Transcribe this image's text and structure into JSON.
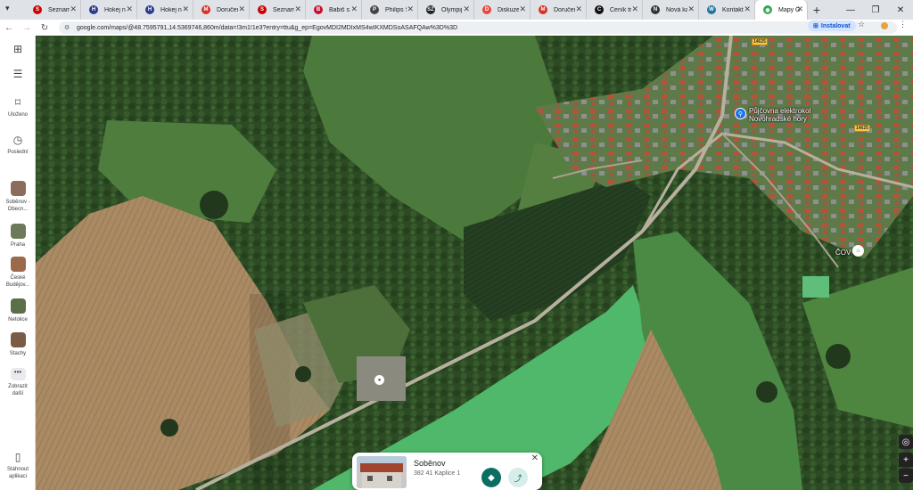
{
  "browser": {
    "tabs": [
      {
        "label": "Seznam",
        "icon": "seznam-icon",
        "color": "#cc0000",
        "glyph": "S"
      },
      {
        "label": "Hokej n",
        "icon": "hockey-icon",
        "color": "#2a3c8f",
        "glyph": "H"
      },
      {
        "label": "Hokej n",
        "icon": "hockey-icon",
        "color": "#2a3c8f",
        "glyph": "H"
      },
      {
        "label": "Doručen",
        "icon": "gmail-icon",
        "color": "#d93025",
        "glyph": "M"
      },
      {
        "label": "Seznam",
        "icon": "seznam-icon",
        "color": "#cc0000",
        "glyph": "S"
      },
      {
        "label": "Babiš s",
        "icon": "news-icon",
        "color": "#c8102e",
        "glyph": "B"
      },
      {
        "label": "Philips S",
        "icon": "philips-icon",
        "color": "#444444",
        "glyph": "P"
      },
      {
        "label": "Olympij",
        "icon": "sz-icon",
        "color": "#222222",
        "glyph": "SZ"
      },
      {
        "label": "Diskuze",
        "icon": "discussion-icon",
        "color": "#e8453c",
        "glyph": "D"
      },
      {
        "label": "Doručen",
        "icon": "gmail-icon",
        "color": "#d93025",
        "glyph": "M"
      },
      {
        "label": "Ceník tr",
        "icon": "price-icon",
        "color": "#111111",
        "glyph": "C"
      },
      {
        "label": "Nová ka",
        "icon": "github-icon",
        "color": "#333333",
        "glyph": "N"
      },
      {
        "label": "Kontakt",
        "icon": "wordpress-icon",
        "color": "#21759b",
        "glyph": "W"
      },
      {
        "label": "Mapy Go",
        "icon": "maps-icon",
        "color": "#34a853",
        "glyph": "◉"
      }
    ],
    "new_tab": "+",
    "url": "google.com/maps/@48.7595791,14.5369746,860m/data=!3m1!1e3?entry=ttu&g_ep=EgovMDI2MDIxMS4wIKXMDSoASAFQAw%3D%3D",
    "install_label": "Instalovat"
  },
  "sidebar": {
    "items": [
      {
        "label": "Uloženo",
        "icon": "bookmark-icon"
      },
      {
        "label": "Poslední",
        "icon": "history-icon"
      },
      {
        "label": "Soběnov - Obecn...",
        "icon": "place-thumb",
        "color": "#8a6d5a"
      },
      {
        "label": "Praha",
        "icon": "place-thumb",
        "color": "#6c7a5a"
      },
      {
        "label": "České Budějov...",
        "icon": "place-thumb",
        "color": "#9a6a4a"
      },
      {
        "label": "Netolice",
        "icon": "place-thumb",
        "color": "#5b6f4b"
      },
      {
        "label": "Stachy",
        "icon": "place-thumb",
        "color": "#7a5b45"
      },
      {
        "label": "Zobrazit další",
        "icon": "more-icon"
      }
    ],
    "download_label": "Stáhnout aplikaci"
  },
  "map": {
    "pois": [
      {
        "label": "Půjčovna elektrokol Novohradské hory",
        "icon": "bicycle-icon"
      },
      {
        "label": "ČOV",
        "icon": "landmark-icon"
      }
    ],
    "road_numbers": [
      "14625",
      "14625"
    ]
  },
  "place_card": {
    "name": "Soběnov",
    "address": "382 41 Kaplice 1"
  }
}
